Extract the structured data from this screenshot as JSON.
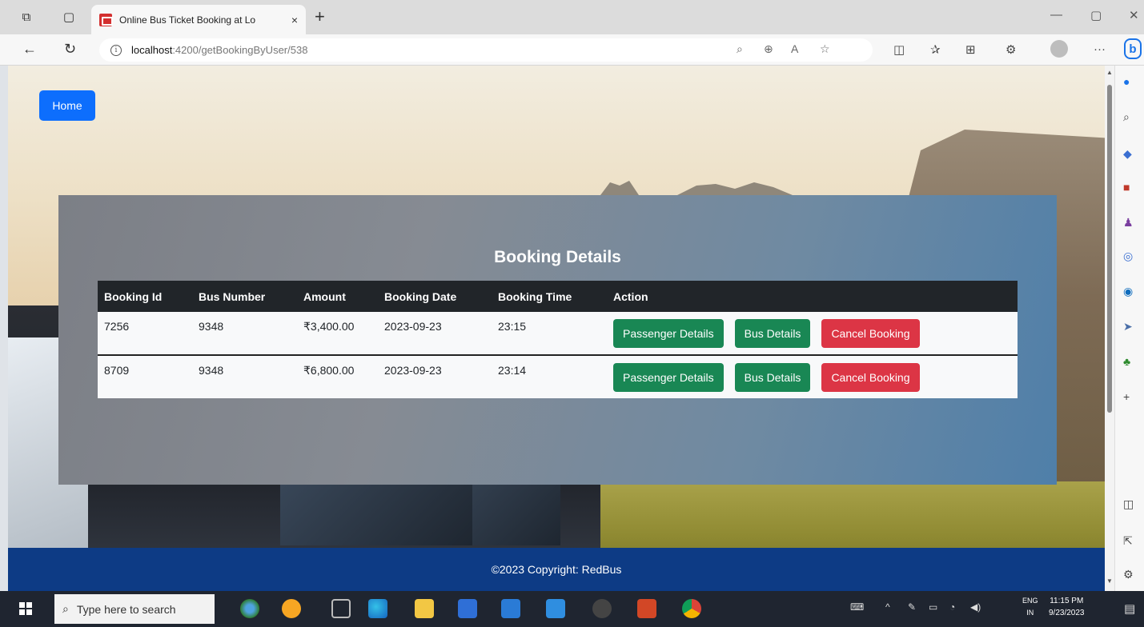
{
  "browser": {
    "tab_title": "Online Bus Ticket Booking at Lo",
    "tab_close": "×",
    "new_tab": "+",
    "url_host": "localhost",
    "url_path": ":4200/getBookingByUser/538"
  },
  "page": {
    "home_label": "Home",
    "heading": "Booking Details",
    "columns": [
      "Booking Id",
      "Bus Number",
      "Amount",
      "Booking Date",
      "Booking Time",
      "Action"
    ],
    "rows": [
      {
        "booking_id": "7256",
        "bus_number": "9348",
        "amount": "₹3,400.00",
        "date": "2023-09-23",
        "time": "23:15"
      },
      {
        "booking_id": "8709",
        "bus_number": "9348",
        "amount": "₹6,800.00",
        "date": "2023-09-23",
        "time": "23:14"
      }
    ],
    "actions": {
      "passenger": "Passenger Details",
      "bus": "Bus Details",
      "cancel": "Cancel Booking"
    },
    "footer": "©2023 Copyright: RedBus"
  },
  "taskbar": {
    "search_placeholder": "Type here to search",
    "lang_top": "ENG",
    "lang_bottom": "IN",
    "time": "11:15 PM",
    "date": "9/23/2023"
  },
  "colors": {
    "primary": "#0d6efd",
    "success": "#198754",
    "danger": "#dc3545",
    "footer": "#0d3b85",
    "table_header": "#212529"
  }
}
